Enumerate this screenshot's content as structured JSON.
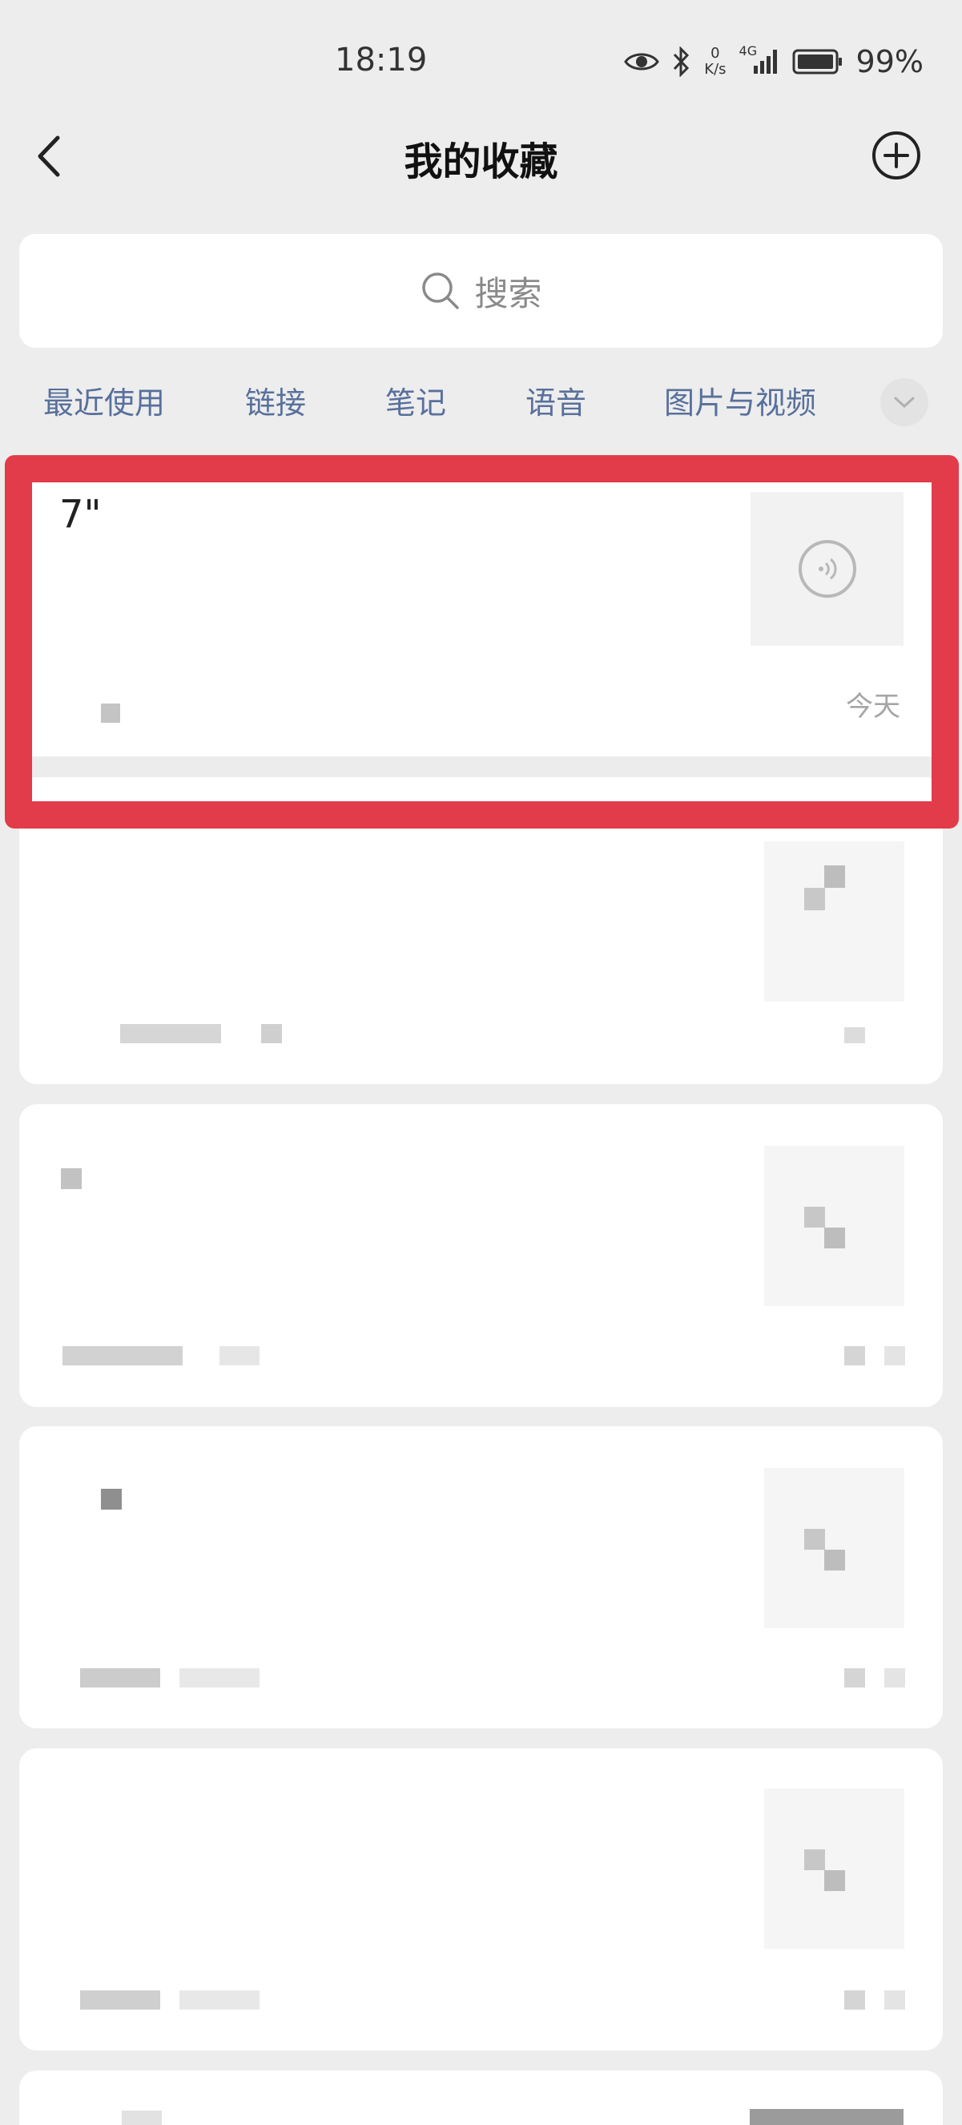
{
  "status_bar": {
    "time": "18:19",
    "netspeed_value": "0",
    "netspeed_unit": "K/s",
    "network": "4G",
    "battery": "99%"
  },
  "nav": {
    "title": "我的收藏"
  },
  "search": {
    "placeholder": "搜索"
  },
  "tabs": [
    {
      "label": "最近使用"
    },
    {
      "label": "链接"
    },
    {
      "label": "笔记"
    },
    {
      "label": "语音"
    },
    {
      "label": "图片与视频"
    }
  ],
  "items": [
    {
      "title": "7\"",
      "date": "今天",
      "type": "voice",
      "highlighted": true
    },
    {
      "title": "",
      "date": "",
      "type": "pixelated"
    },
    {
      "title": "",
      "date": "",
      "type": "pixelated"
    },
    {
      "title": "",
      "date": "",
      "type": "pixelated"
    },
    {
      "title": "",
      "date": "",
      "type": "pixelated"
    }
  ],
  "colors": {
    "background": "#ededed",
    "tab_text": "#58709c",
    "highlight_frame": "#e23b4a"
  }
}
